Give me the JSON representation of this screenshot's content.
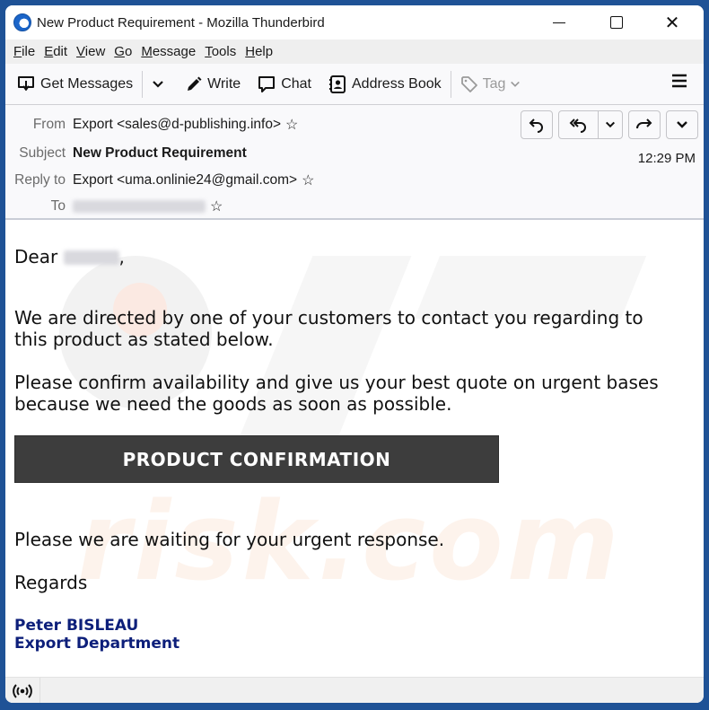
{
  "window": {
    "title": "New Product Requirement - Mozilla Thunderbird",
    "controls": {
      "minimize": "minimize",
      "maximize": "maximize",
      "close": "close"
    }
  },
  "menubar": {
    "items": [
      {
        "label": "File",
        "accel": "F",
        "rest": "ile"
      },
      {
        "label": "Edit",
        "accel": "E",
        "rest": "dit"
      },
      {
        "label": "View",
        "accel": "V",
        "rest": "iew"
      },
      {
        "label": "Go",
        "accel": "G",
        "rest": "o"
      },
      {
        "label": "Message",
        "accel": "M",
        "rest": "essage"
      },
      {
        "label": "Tools",
        "accel": "T",
        "rest": "ools"
      },
      {
        "label": "Help",
        "accel": "H",
        "rest": "elp"
      }
    ]
  },
  "toolbar": {
    "get_messages": "Get Messages",
    "write": "Write",
    "chat": "Chat",
    "address_book": "Address Book",
    "tag": "Tag"
  },
  "header": {
    "from_label": "From",
    "from_value": "Export <sales@d-publishing.info>",
    "subject_label": "Subject",
    "subject_value": "New Product Requirement",
    "reply_to_label": "Reply to",
    "reply_to_value": "Export <uma.onlinie24@gmail.com>",
    "to_label": "To",
    "to_value_redacted": true,
    "time": "12:29 PM",
    "actions": [
      "reply",
      "reply-all",
      "reply-all-menu",
      "forward",
      "more"
    ]
  },
  "message": {
    "greeting_prefix": "Dear",
    "greeting_suffix": ",",
    "para1_line1": "We are directed by one of your customers to contact you regarding to",
    "para1_line2": "this product as stated below.",
    "para2_line1": "Please confirm availability and give us your best quote on urgent bases",
    "para2_line2": "because we need the goods as soon as possible.",
    "cta_button": "PRODUCT CONFIRMATION",
    "para3": "Please we are waiting for your urgent response.",
    "regards": "Regards",
    "signature_name": "Peter BISLEAU",
    "signature_dept": "Export Department"
  },
  "watermark": {
    "text": "risk.com"
  },
  "colors": {
    "desktop": "#1f5296",
    "cta_bg": "#3d3d3d",
    "signature": "#0d1f7a"
  }
}
